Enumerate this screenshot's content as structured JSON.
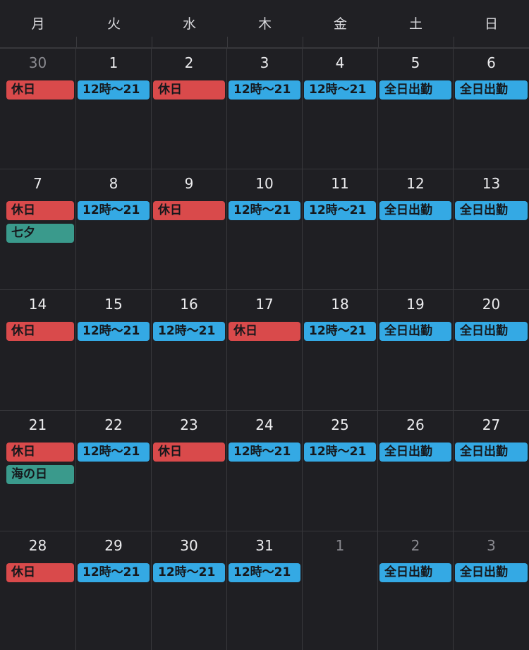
{
  "colors": {
    "background": "#1f1f23",
    "grid_line": "#38383c",
    "day_off": "#d94a4b",
    "shift": "#34a9e4",
    "holiday": "#3a9a8c"
  },
  "weekdays": [
    "月",
    "火",
    "水",
    "木",
    "金",
    "土",
    "日"
  ],
  "weeks": [
    {
      "days": [
        {
          "number": "30",
          "muted": true,
          "events": [
            {
              "label": "休日",
              "kind": "day-off"
            }
          ]
        },
        {
          "number": "1",
          "muted": false,
          "events": [
            {
              "label": "12時～21",
              "kind": "shift"
            }
          ]
        },
        {
          "number": "2",
          "muted": false,
          "events": [
            {
              "label": "休日",
              "kind": "day-off"
            }
          ]
        },
        {
          "number": "3",
          "muted": false,
          "events": [
            {
              "label": "12時～21",
              "kind": "shift"
            }
          ]
        },
        {
          "number": "4",
          "muted": false,
          "events": [
            {
              "label": "12時～21",
              "kind": "shift"
            }
          ]
        },
        {
          "number": "5",
          "muted": false,
          "events": [
            {
              "label": "全日出勤",
              "kind": "allday"
            }
          ]
        },
        {
          "number": "6",
          "muted": false,
          "events": [
            {
              "label": "全日出勤",
              "kind": "allday"
            }
          ]
        }
      ]
    },
    {
      "days": [
        {
          "number": "7",
          "muted": false,
          "events": [
            {
              "label": "休日",
              "kind": "day-off"
            },
            {
              "label": "七夕",
              "kind": "holiday"
            }
          ]
        },
        {
          "number": "8",
          "muted": false,
          "events": [
            {
              "label": "12時～21",
              "kind": "shift"
            }
          ]
        },
        {
          "number": "9",
          "muted": false,
          "events": [
            {
              "label": "休日",
              "kind": "day-off"
            }
          ]
        },
        {
          "number": "10",
          "muted": false,
          "events": [
            {
              "label": "12時～21",
              "kind": "shift"
            }
          ]
        },
        {
          "number": "11",
          "muted": false,
          "events": [
            {
              "label": "12時～21",
              "kind": "shift"
            }
          ]
        },
        {
          "number": "12",
          "muted": false,
          "events": [
            {
              "label": "全日出勤",
              "kind": "allday"
            }
          ]
        },
        {
          "number": "13",
          "muted": false,
          "events": [
            {
              "label": "全日出勤",
              "kind": "allday"
            }
          ]
        }
      ]
    },
    {
      "days": [
        {
          "number": "14",
          "muted": false,
          "events": [
            {
              "label": "休日",
              "kind": "day-off"
            }
          ]
        },
        {
          "number": "15",
          "muted": false,
          "events": [
            {
              "label": "12時～21",
              "kind": "shift"
            }
          ]
        },
        {
          "number": "16",
          "muted": false,
          "events": [
            {
              "label": "12時～21",
              "kind": "shift"
            }
          ]
        },
        {
          "number": "17",
          "muted": false,
          "events": [
            {
              "label": "休日",
              "kind": "day-off"
            }
          ]
        },
        {
          "number": "18",
          "muted": false,
          "events": [
            {
              "label": "12時～21",
              "kind": "shift"
            }
          ]
        },
        {
          "number": "19",
          "muted": false,
          "events": [
            {
              "label": "全日出勤",
              "kind": "allday"
            }
          ]
        },
        {
          "number": "20",
          "muted": false,
          "events": [
            {
              "label": "全日出勤",
              "kind": "allday"
            }
          ]
        }
      ]
    },
    {
      "days": [
        {
          "number": "21",
          "muted": false,
          "events": [
            {
              "label": "休日",
              "kind": "day-off"
            },
            {
              "label": "海の日",
              "kind": "holiday"
            }
          ]
        },
        {
          "number": "22",
          "muted": false,
          "events": [
            {
              "label": "12時～21",
              "kind": "shift"
            }
          ]
        },
        {
          "number": "23",
          "muted": false,
          "events": [
            {
              "label": "休日",
              "kind": "day-off"
            }
          ]
        },
        {
          "number": "24",
          "muted": false,
          "events": [
            {
              "label": "12時～21",
              "kind": "shift"
            }
          ]
        },
        {
          "number": "25",
          "muted": false,
          "events": [
            {
              "label": "12時～21",
              "kind": "shift"
            }
          ]
        },
        {
          "number": "26",
          "muted": false,
          "events": [
            {
              "label": "全日出勤",
              "kind": "allday"
            }
          ]
        },
        {
          "number": "27",
          "muted": false,
          "events": [
            {
              "label": "全日出勤",
              "kind": "allday"
            }
          ]
        }
      ]
    },
    {
      "days": [
        {
          "number": "28",
          "muted": false,
          "events": [
            {
              "label": "休日",
              "kind": "day-off"
            }
          ]
        },
        {
          "number": "29",
          "muted": false,
          "events": [
            {
              "label": "12時～21",
              "kind": "shift"
            }
          ]
        },
        {
          "number": "30",
          "muted": false,
          "events": [
            {
              "label": "12時～21",
              "kind": "shift"
            }
          ]
        },
        {
          "number": "31",
          "muted": false,
          "events": [
            {
              "label": "12時～21",
              "kind": "shift"
            }
          ]
        },
        {
          "number": "1",
          "muted": true,
          "events": []
        },
        {
          "number": "2",
          "muted": true,
          "events": [
            {
              "label": "全日出勤",
              "kind": "allday"
            }
          ]
        },
        {
          "number": "3",
          "muted": true,
          "events": [
            {
              "label": "全日出勤",
              "kind": "allday"
            }
          ]
        }
      ]
    }
  ]
}
